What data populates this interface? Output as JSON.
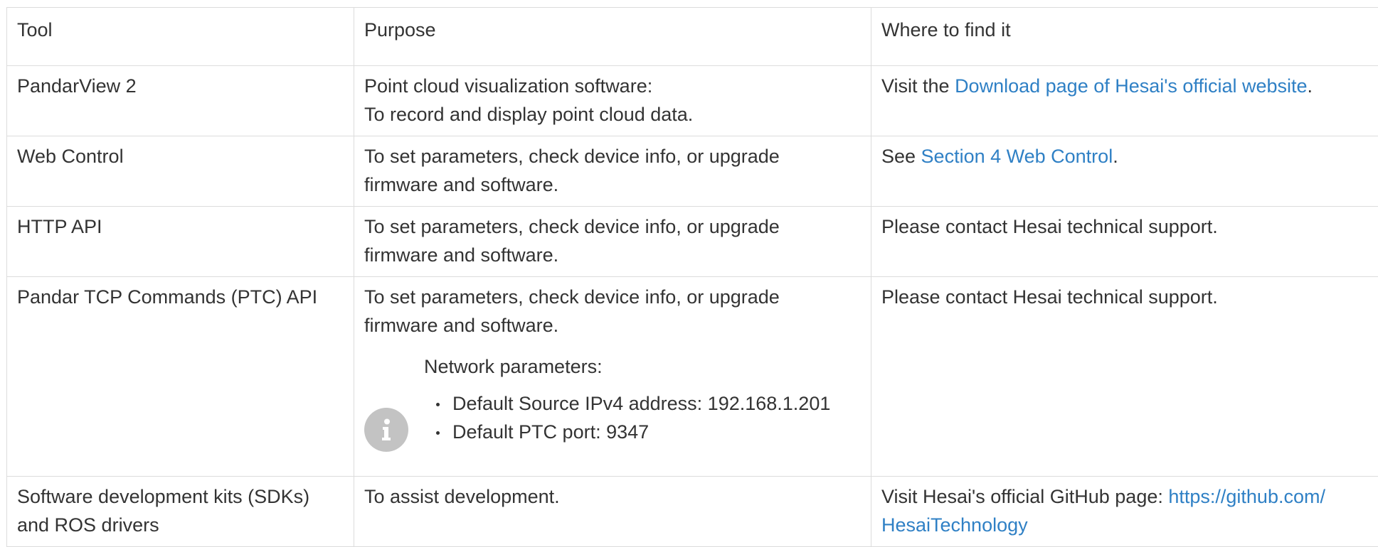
{
  "table": {
    "headers": [
      "Tool",
      "Purpose",
      "Where to find it"
    ],
    "rows": [
      {
        "tool": "PandarView 2",
        "purpose": [
          "Point cloud visualization software:",
          "To record and display point cloud data."
        ],
        "where_prefix": "Visit the ",
        "where_link": "Download page of Hesai's official website",
        "where_suffix": "."
      },
      {
        "tool": "Web Control",
        "purpose": [
          "To set parameters, check device info, or upgrade",
          "firmware and software."
        ],
        "where_prefix": "See ",
        "where_link": "Section 4 Web Control",
        "where_suffix": "."
      },
      {
        "tool": "HTTP API",
        "purpose": [
          "To set parameters, check device info, or upgrade",
          "firmware and software."
        ],
        "where_text": "Please contact Hesai technical support."
      },
      {
        "tool": "Pandar TCP Commands (PTC) API",
        "purpose": [
          "To set parameters, check device info, or upgrade",
          "firmware and software."
        ],
        "note": {
          "icon": "info-icon",
          "title": "Network parameters:",
          "items": [
            "Default Source IPv4 address: 192.168.1.201",
            "Default PTC port: 9347"
          ]
        },
        "where_text": "Please contact Hesai technical support."
      },
      {
        "tool": [
          "Software development kits (SDKs)",
          "and ROS drivers"
        ],
        "purpose": [
          "To assist development."
        ],
        "where_prefix": "Visit Hesai's official GitHub page: ",
        "where_link": [
          "https://github.com/",
          "HesaiTechnology"
        ]
      }
    ]
  },
  "colors": {
    "link": "#2f80c5",
    "text": "#333333",
    "border": "#dcdcdc",
    "info_icon_bg": "#c3c3c3"
  }
}
